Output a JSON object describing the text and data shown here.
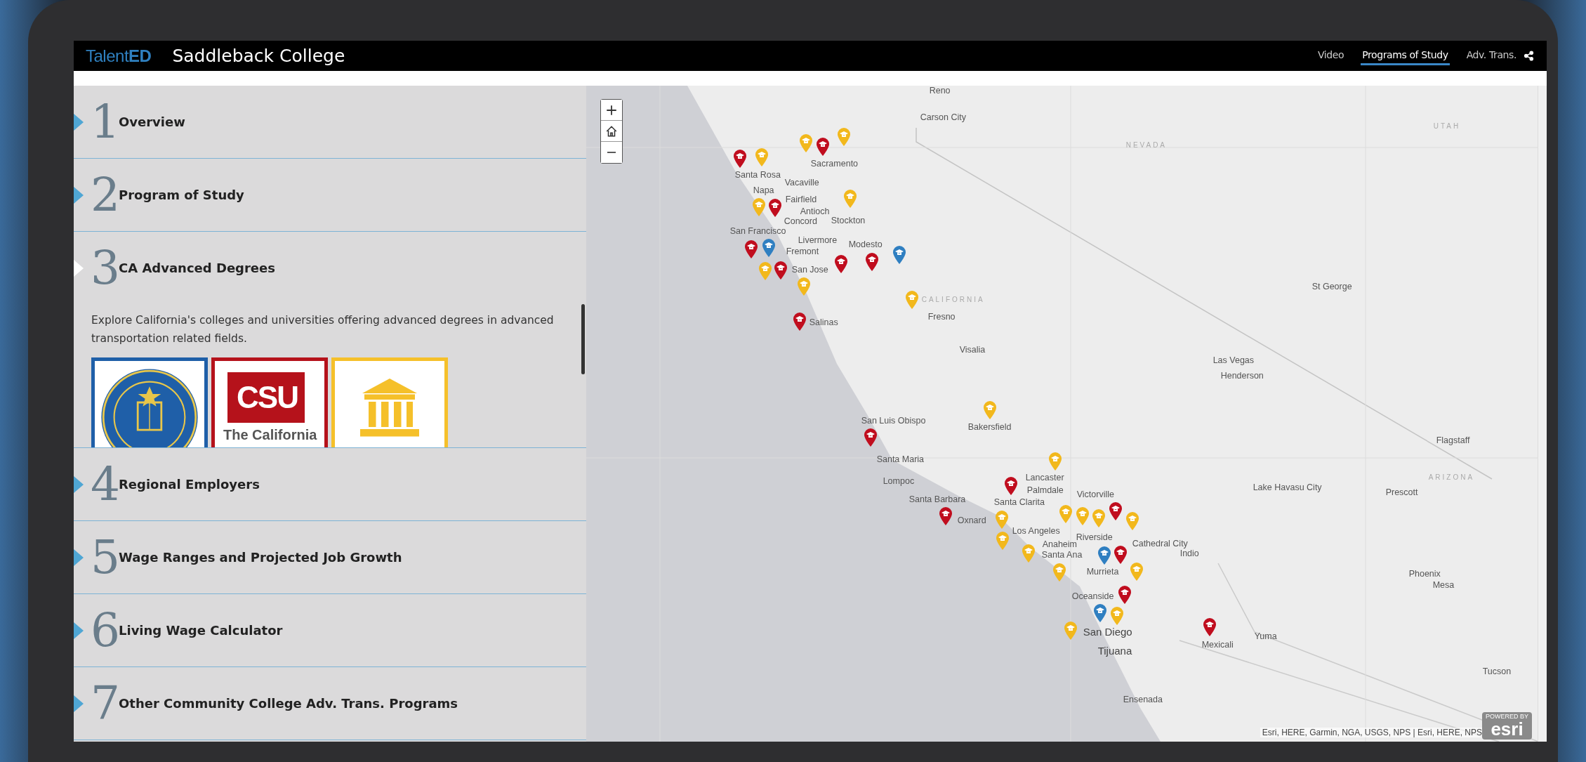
{
  "header": {
    "brand": "Talent**ED**",
    "title": "Saddleback College",
    "nav": [
      {
        "label": "Video",
        "selected": false
      },
      {
        "label": "Programs of Study",
        "selected": true
      },
      {
        "label": "Adv. Trans.",
        "selected": false
      }
    ]
  },
  "sections": [
    {
      "number": "1",
      "title": "Overview",
      "selected": false
    },
    {
      "number": "2",
      "title": "Program of Study",
      "selected": false
    },
    {
      "number": "3",
      "title": "CA Advanced Degrees",
      "selected": true,
      "description": "Explore California's colleges and universities offering advanced degrees in advanced transportation related fields.",
      "logos": [
        {
          "kind": "seal",
          "color": "#1f5fa8"
        },
        {
          "kind": "csu",
          "color": "#b5121b",
          "mark": "CSU",
          "caption": "The California"
        },
        {
          "kind": "building",
          "color": "#f5c02a"
        }
      ]
    },
    {
      "number": "4",
      "title": "Regional Employers",
      "selected": false
    },
    {
      "number": "5",
      "title": "Wage Ranges and Projected Job Growth",
      "selected": false
    },
    {
      "number": "6",
      "title": "Living Wage Calculator",
      "selected": false
    },
    {
      "number": "7",
      "title": "Other Community College Adv. Trans. Programs",
      "selected": false
    }
  ],
  "map": {
    "labels": [
      {
        "text": "Reno",
        "kind": "city"
      },
      {
        "text": "Carson City",
        "kind": "city"
      },
      {
        "text": "NEVADA",
        "kind": "state"
      },
      {
        "text": "UTAH",
        "kind": "state"
      },
      {
        "text": "Sacramento",
        "kind": "city"
      },
      {
        "text": "Santa Rosa",
        "kind": "city"
      },
      {
        "text": "Vacaville",
        "kind": "city"
      },
      {
        "text": "Napa",
        "kind": "city"
      },
      {
        "text": "Fairfield",
        "kind": "city"
      },
      {
        "text": "Antioch",
        "kind": "city"
      },
      {
        "text": "Concord",
        "kind": "city"
      },
      {
        "text": "Stockton",
        "kind": "city"
      },
      {
        "text": "San Francisco",
        "kind": "city"
      },
      {
        "text": "Livermore",
        "kind": "city"
      },
      {
        "text": "Modesto",
        "kind": "city"
      },
      {
        "text": "Fremont",
        "kind": "city"
      },
      {
        "text": "San Jose",
        "kind": "city"
      },
      {
        "text": "CALIFORNIA",
        "kind": "state"
      },
      {
        "text": "Fresno",
        "kind": "city"
      },
      {
        "text": "Salinas",
        "kind": "city"
      },
      {
        "text": "Visalia",
        "kind": "city"
      },
      {
        "text": "St George",
        "kind": "city"
      },
      {
        "text": "Las Vegas",
        "kind": "city"
      },
      {
        "text": "Henderson",
        "kind": "city"
      },
      {
        "text": "San Luis Obispo",
        "kind": "city"
      },
      {
        "text": "Bakersfield",
        "kind": "city"
      },
      {
        "text": "Flagstaff",
        "kind": "city"
      },
      {
        "text": "Santa Maria",
        "kind": "city"
      },
      {
        "text": "Lompoc",
        "kind": "city"
      },
      {
        "text": "Lancaster",
        "kind": "city"
      },
      {
        "text": "Palmdale",
        "kind": "city"
      },
      {
        "text": "Victorville",
        "kind": "city"
      },
      {
        "text": "Santa Barbara",
        "kind": "city"
      },
      {
        "text": "Santa Clarita",
        "kind": "city"
      },
      {
        "text": "Lake Havasu City",
        "kind": "city"
      },
      {
        "text": "Prescott",
        "kind": "city"
      },
      {
        "text": "ARIZONA",
        "kind": "state"
      },
      {
        "text": "Oxnard",
        "kind": "city"
      },
      {
        "text": "Los Angeles",
        "kind": "city"
      },
      {
        "text": "Riverside",
        "kind": "city"
      },
      {
        "text": "Cathedral City",
        "kind": "city"
      },
      {
        "text": "Indio",
        "kind": "city"
      },
      {
        "text": "Anaheim",
        "kind": "city"
      },
      {
        "text": "Santa Ana",
        "kind": "city"
      },
      {
        "text": "Murrieta",
        "kind": "city"
      },
      {
        "text": "Phoenix",
        "kind": "city"
      },
      {
        "text": "Mesa",
        "kind": "city"
      },
      {
        "text": "Oceanside",
        "kind": "city"
      },
      {
        "text": "San Diego",
        "kind": "major"
      },
      {
        "text": "Yuma",
        "kind": "city"
      },
      {
        "text": "Mexicali",
        "kind": "city"
      },
      {
        "text": "Tijuana",
        "kind": "major"
      },
      {
        "text": "Tucson",
        "kind": "city"
      },
      {
        "text": "Ensenada",
        "kind": "city"
      }
    ],
    "pins": [
      {
        "color": "#f2b81c"
      },
      {
        "color": "#f2b81c"
      },
      {
        "color": "#c00d1e"
      },
      {
        "color": "#c00d1e"
      },
      {
        "color": "#f2b81c"
      },
      {
        "color": "#c00d1e"
      },
      {
        "color": "#f2b81c"
      },
      {
        "color": "#2f7fc1"
      },
      {
        "color": "#f2b81c"
      },
      {
        "color": "#c00d1e"
      },
      {
        "color": "#c00d1e"
      },
      {
        "color": "#f2b81c"
      },
      {
        "color": "#f2b81c"
      },
      {
        "color": "#c00d1e"
      },
      {
        "color": "#c00d1e"
      },
      {
        "color": "#2f7fc1"
      },
      {
        "color": "#f2b81c"
      },
      {
        "color": "#c00d1e"
      },
      {
        "color": "#c00d1e"
      },
      {
        "color": "#f2b81c"
      },
      {
        "color": "#f2b81c"
      },
      {
        "color": "#c00d1e"
      },
      {
        "color": "#f2b81c"
      },
      {
        "color": "#c00d1e"
      },
      {
        "color": "#f2b81c"
      },
      {
        "color": "#f2b81c"
      },
      {
        "color": "#f2b81c"
      },
      {
        "color": "#f2b81c"
      },
      {
        "color": "#c00d1e"
      },
      {
        "color": "#2f7fc1"
      },
      {
        "color": "#f2b81c"
      },
      {
        "color": "#f2b81c"
      },
      {
        "color": "#f2b81c"
      },
      {
        "color": "#c00d1e"
      },
      {
        "color": "#f2b81c"
      },
      {
        "color": "#c00d1e"
      },
      {
        "color": "#2f7fc1"
      },
      {
        "color": "#f2b81c"
      },
      {
        "color": "#f2b81c"
      },
      {
        "color": "#c00d1e"
      }
    ],
    "attribution": "Esri, HERE, Garmin, NGA, USGS, NPS | Esri, HERE, NPS",
    "logo_caption": "POWERED BY",
    "logo": "esri"
  }
}
